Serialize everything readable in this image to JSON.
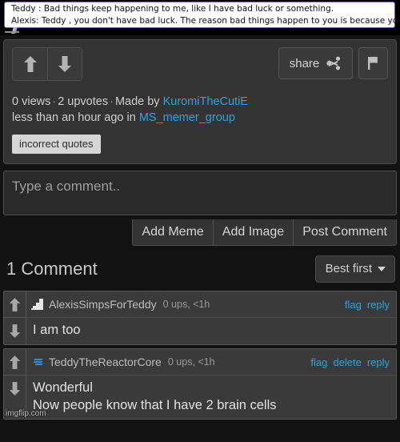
{
  "meme": {
    "line1": "Teddy : Bad things keep happening to me, like I have bad luck or something.",
    "line2": "Alexis: Teddy , you don't have bad luck. The reason bad things happen to you is because you're a dumbass."
  },
  "post": {
    "upvote_icon": "arrow-up-icon",
    "downvote_icon": "arrow-down-icon",
    "share_label": "share",
    "share_icon": "share-icon",
    "flag_icon": "flag-icon",
    "views": "0 views",
    "upvotes": "2 upvotes",
    "made_by_prefix": "Made by",
    "author": "KuromiTheCutiE",
    "time_prefix": "less than an hour ago in",
    "stream": "MS_memer_group",
    "separator": "·",
    "tag": "incorrect quotes"
  },
  "compose": {
    "placeholder": "Type a comment..",
    "value": "",
    "add_meme_label": "Add Meme",
    "add_image_label": "Add Image",
    "post_label": "Post Comment"
  },
  "comments_header": {
    "title": "1 Comment",
    "sort_label": "Best first",
    "sort_caret_icon": "chevron-down-icon"
  },
  "comments": [
    {
      "avatar_icon": "avatar-pixel-a-icon",
      "username": "AlexisSimpsForTeddy",
      "stats": "0 ups, <1h",
      "actions": [
        "flag",
        "reply"
      ],
      "body_lines": [
        "I am too"
      ]
    },
    {
      "avatar_icon": "avatar-blue-s-icon",
      "username": "TeddyTheReactorCore",
      "stats": "0 ups, <1h",
      "actions": [
        "flag",
        "delete",
        "reply"
      ],
      "body_lines": [
        "Wonderful",
        "Now people know that I have 2 brain cells"
      ]
    }
  ],
  "watermark": "imgflip.com",
  "colors": {
    "link": "#28a5e0",
    "panel": "#333333",
    "page_bg": "#121212",
    "bubble_border": "#7b5ea7",
    "avatar_blue": "#2f8fd6"
  }
}
